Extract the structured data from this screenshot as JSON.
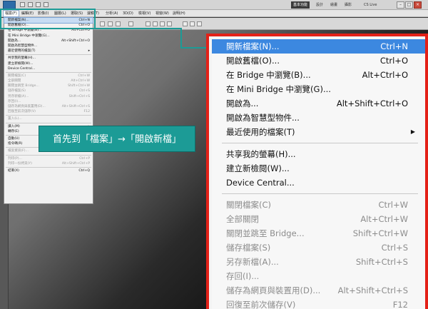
{
  "workspace": {
    "buttons": [
      "基本功能",
      "設計",
      "繪畫",
      "攝影"
    ],
    "cs_live": "CS Live"
  },
  "menubar": [
    "檔案(F)",
    "編輯(E)",
    "影像(I)",
    "圖層(L)",
    "選取(S)",
    "濾鏡(T)",
    "分析(A)",
    "3D(D)",
    "檢視(V)",
    "視窗(W)",
    "說明(H)"
  ],
  "small_menu": [
    {
      "label": "開新檔案(N)...",
      "shortcut": "Ctrl+N",
      "state": "hl"
    },
    {
      "label": "開啟舊檔(O)...",
      "shortcut": "Ctrl+O",
      "state": ""
    },
    {
      "label": "在 Bridge 中瀏覽(B)...",
      "shortcut": "Alt+Ctrl+O",
      "state": ""
    },
    {
      "label": "在 Mini Bridge 中瀏覽(G)...",
      "shortcut": "",
      "state": ""
    },
    {
      "label": "開啟為...",
      "shortcut": "Alt+Shift+Ctrl+O",
      "state": ""
    },
    {
      "label": "開啟為智慧型物件...",
      "shortcut": "",
      "state": ""
    },
    {
      "label": "最近使用的檔案(T)",
      "shortcut": "▸",
      "state": ""
    },
    "sep",
    {
      "label": "共享我的螢幕(H)...",
      "shortcut": "",
      "state": ""
    },
    {
      "label": "建立新檢閱(W)...",
      "shortcut": "",
      "state": ""
    },
    {
      "label": "Device Central...",
      "shortcut": "",
      "state": ""
    },
    "sep",
    {
      "label": "關閉檔案(C)",
      "shortcut": "Ctrl+W",
      "state": "dis"
    },
    {
      "label": "全部關閉",
      "shortcut": "Alt+Ctrl+W",
      "state": "dis"
    },
    {
      "label": "關閉並跳至 Bridge...",
      "shortcut": "Shift+Ctrl+W",
      "state": "dis"
    },
    {
      "label": "儲存檔案(S)",
      "shortcut": "Ctrl+S",
      "state": "dis"
    },
    {
      "label": "另存新檔(A)...",
      "shortcut": "Shift+Ctrl+S",
      "state": "dis"
    },
    {
      "label": "存回(I)...",
      "shortcut": "",
      "state": "dis"
    },
    {
      "label": "儲存為網頁與裝置用(D)...",
      "shortcut": "Alt+Shift+Ctrl+S",
      "state": "dis"
    },
    {
      "label": "回復至前次儲存(V)",
      "shortcut": "F12",
      "state": "dis"
    },
    "sep",
    {
      "label": "置入(L)...",
      "shortcut": "",
      "state": "dis"
    },
    "sep",
    {
      "label": "讀入(M)",
      "shortcut": "▸",
      "state": ""
    },
    {
      "label": "轉存(E)",
      "shortcut": "▸",
      "state": ""
    },
    "sep",
    {
      "label": "自動(U)",
      "shortcut": "▸",
      "state": ""
    },
    {
      "label": "指令碼(R)",
      "shortcut": "▸",
      "state": ""
    },
    "sep",
    {
      "label": "檔案資訊(F)...",
      "shortcut": "Alt+Shift+Ctrl+I",
      "state": "dis"
    },
    "sep",
    {
      "label": "列印(P)...",
      "shortcut": "Ctrl+P",
      "state": "dis"
    },
    {
      "label": "列印一份拷貝(Y)",
      "shortcut": "Alt+Shift+Ctrl+P",
      "state": "dis"
    },
    "sep",
    {
      "label": "結束(X)",
      "shortcut": "Ctrl+Q",
      "state": ""
    }
  ],
  "callout": "首先到「檔案」→「開啟新檔」",
  "zoom_menu": [
    {
      "label": "開新檔案(N)...",
      "shortcut": "Ctrl+N",
      "state": "hl"
    },
    {
      "label": "開啟舊檔(O)...",
      "shortcut": "Ctrl+O",
      "state": ""
    },
    {
      "label": "在 Bridge 中瀏覽(B)...",
      "shortcut": "Alt+Ctrl+O",
      "state": ""
    },
    {
      "label": "在 Mini Bridge 中瀏覽(G)...",
      "shortcut": "",
      "state": ""
    },
    {
      "label": "開啟為...",
      "shortcut": "Alt+Shift+Ctrl+O",
      "state": ""
    },
    {
      "label": "開啟為智慧型物件...",
      "shortcut": "",
      "state": ""
    },
    {
      "label": "最近使用的檔案(T)",
      "shortcut": "",
      "arrow": "▶",
      "state": ""
    },
    "sep",
    {
      "label": "共享我的螢幕(H)...",
      "shortcut": "",
      "state": ""
    },
    {
      "label": "建立新檢閱(W)...",
      "shortcut": "",
      "state": ""
    },
    {
      "label": "Device Central...",
      "shortcut": "",
      "state": ""
    },
    "sep",
    {
      "label": "關閉檔案(C)",
      "shortcut": "Ctrl+W",
      "state": "dis"
    },
    {
      "label": "全部關閉",
      "shortcut": "Alt+Ctrl+W",
      "state": "dis"
    },
    {
      "label": "關閉並跳至 Bridge...",
      "shortcut": "Shift+Ctrl+W",
      "state": "dis"
    },
    {
      "label": "儲存檔案(S)",
      "shortcut": "Ctrl+S",
      "state": "dis"
    },
    {
      "label": "另存新檔(A)...",
      "shortcut": "Shift+Ctrl+S",
      "state": "dis"
    },
    {
      "label": "存回(I)...",
      "shortcut": "",
      "state": "dis"
    },
    {
      "label": "儲存為網頁與裝置用(D)...",
      "shortcut": "Alt+Shift+Ctrl+S",
      "state": "dis"
    },
    {
      "label": "回復至前次儲存(V)",
      "shortcut": "F12",
      "state": "dis"
    }
  ],
  "colors": {
    "teal": "#1c9b96",
    "red_frame": "#e32118",
    "highlight": "#3c88e0"
  }
}
